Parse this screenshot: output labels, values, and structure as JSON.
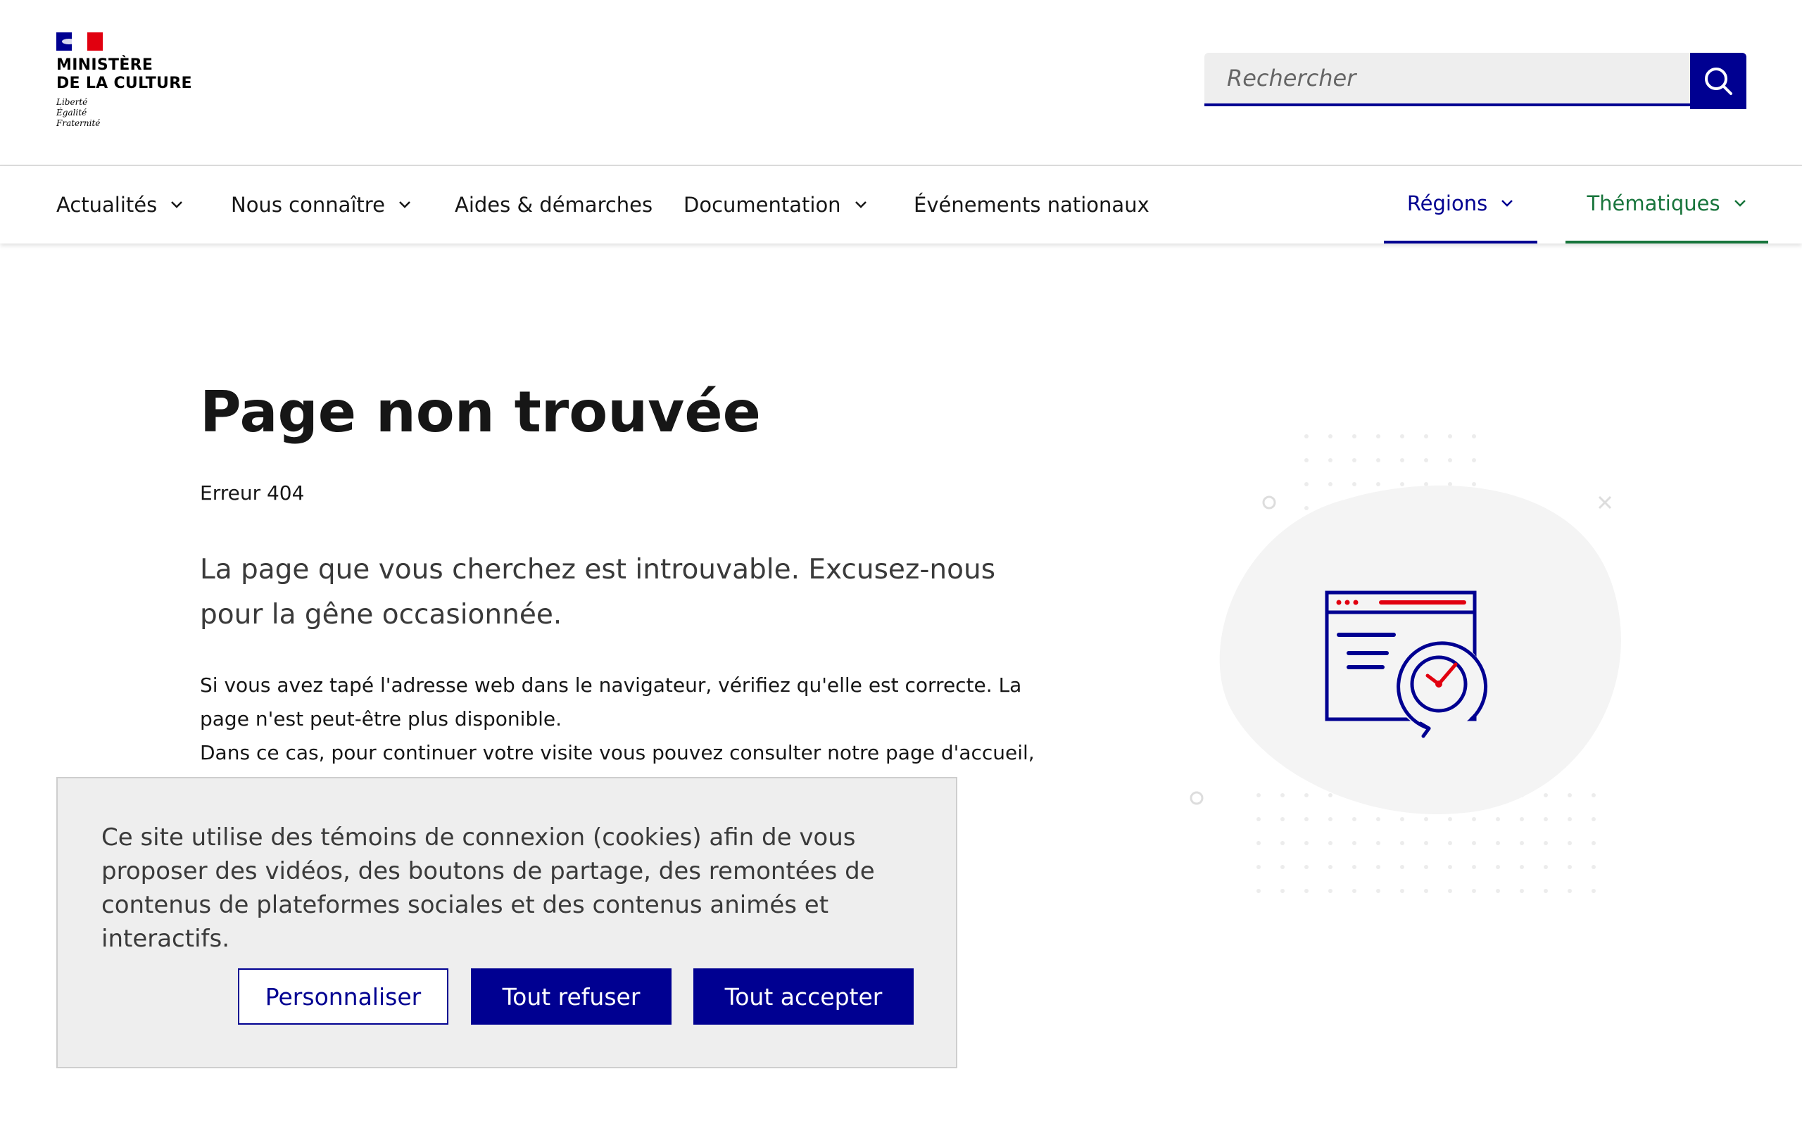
{
  "header": {
    "logo": {
      "line1": "MINISTÈRE",
      "line2": "DE LA CULTURE",
      "motto": [
        "Liberté",
        "Égalité",
        "Fraternité"
      ]
    },
    "search": {
      "placeholder": "Rechercher",
      "button_icon": "search-icon"
    }
  },
  "nav": {
    "items": [
      {
        "label": "Actualités",
        "has_dropdown": true
      },
      {
        "label": "Nous connaître",
        "has_dropdown": true
      },
      {
        "label": "Aides & démarches",
        "has_dropdown": false
      },
      {
        "label": "Documentation",
        "has_dropdown": true
      },
      {
        "label": "Événements nationaux",
        "has_dropdown": false
      }
    ],
    "regions": {
      "label": "Régions",
      "color": "#000091"
    },
    "themes": {
      "label": "Thématiques",
      "color": "#18753c"
    }
  },
  "main": {
    "title": "Page non trouvée",
    "error_code": "Erreur 404",
    "lead": "La page que vous cherchez est introuvable. Excusez-nous pour la gêne occasionnée.",
    "body_line1": "Si vous avez tapé l'adresse web dans le navigateur, vérifiez qu'elle est correcte. La page n'est peut-être plus disponible.",
    "body_line2": "Dans ce cas, pour continuer votre visite vous pouvez consulter notre page d'accueil, ou"
  },
  "illustration": {
    "icon": "browser-window-clock-icon"
  },
  "cookie_banner": {
    "text": "Ce site utilise des témoins de connexion (cookies) afin de vous proposer des vidéos, des boutons de partage, des remontées de contenus de plateformes sociales et des contenus animés et interactifs.",
    "buttons": {
      "customize": "Personnaliser",
      "refuse": "Tout refuser",
      "accept": "Tout accepter"
    }
  },
  "colors": {
    "brand_blue": "#000091",
    "brand_red": "#e1000f",
    "theme_green": "#18753c",
    "banner_bg": "#eeeeee"
  }
}
